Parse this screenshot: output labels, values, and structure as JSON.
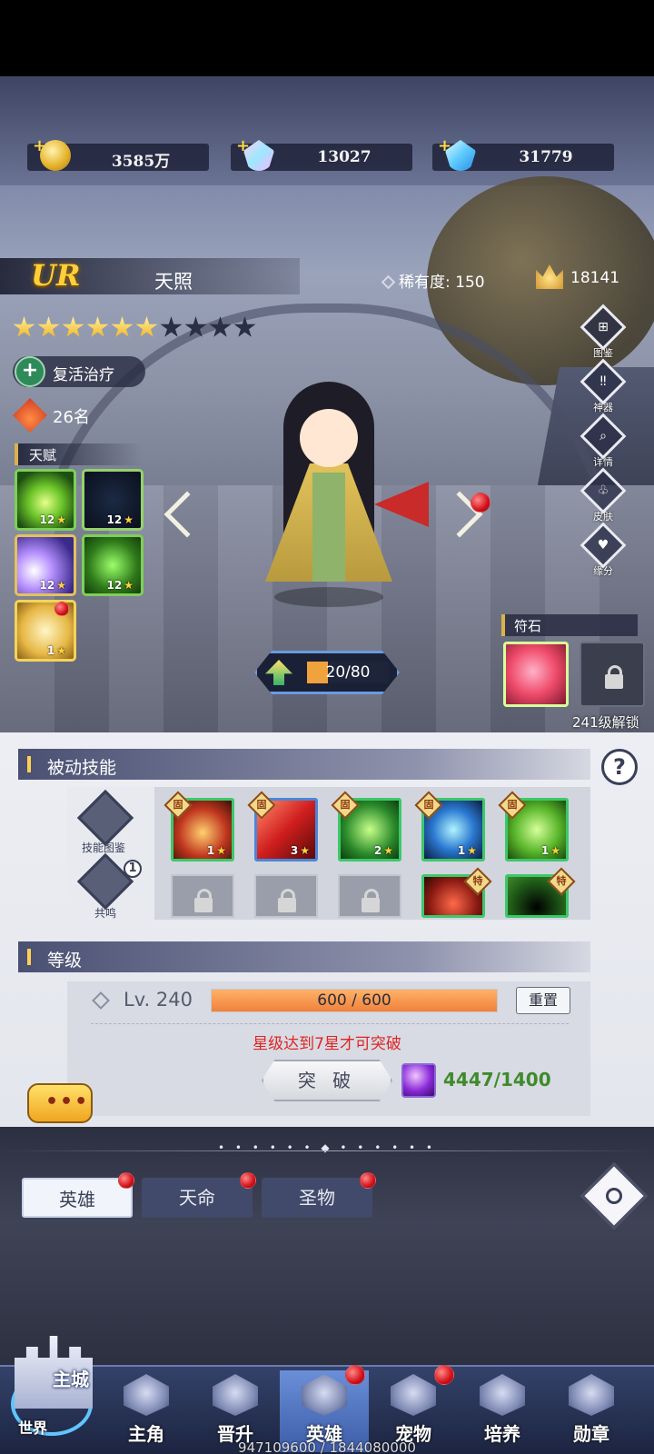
{
  "currency": {
    "gold": "3585万",
    "crystal": "13027",
    "diamond": "31779"
  },
  "hero": {
    "grade": "UR",
    "name": "天照",
    "rarity_label": "稀有度:",
    "rarity_value": "150",
    "power": "18141",
    "stars_total": 10,
    "stars_lit": 6,
    "role": "复活治疗",
    "rank": "26名"
  },
  "talent": {
    "title": "天赋",
    "skills": [
      {
        "icon": "green-vortex-icon",
        "level": "12"
      },
      {
        "icon": "silhouette-duo-icon",
        "level": "12"
      },
      {
        "icon": "purple-slash-icon",
        "level": "12"
      },
      {
        "icon": "green-dragon-icon",
        "level": "12"
      },
      {
        "icon": "gold-shield-icon",
        "level": "1"
      }
    ]
  },
  "side_menu": [
    {
      "icon": "codex-icon",
      "label": "图鉴"
    },
    {
      "icon": "artifact-icon",
      "label": "神器"
    },
    {
      "icon": "detail-icon",
      "label": "详情"
    },
    {
      "icon": "skin-icon",
      "label": "皮肤"
    },
    {
      "icon": "bond-icon",
      "label": "缘分"
    }
  ],
  "level_progress": {
    "text": "20/80",
    "fraction": 0.25
  },
  "rune": {
    "title": "符石",
    "unlock_text": "241级解锁"
  },
  "passive": {
    "title": "被动技能",
    "help": "?",
    "left_buttons": {
      "codex": "技能图鉴",
      "resonance": "共鸣",
      "resonance_badge": "1"
    },
    "fixed_tag": "固",
    "special_tag": "特",
    "skills": [
      {
        "icon": "bomb-soldier-icon",
        "level": "1"
      },
      {
        "icon": "red-sword-icon",
        "level": "3"
      },
      {
        "icon": "green-bamboo-icon",
        "level": "2"
      },
      {
        "icon": "blue-vortex-icon",
        "level": "1"
      },
      {
        "icon": "green-leaf-icon",
        "level": "1"
      }
    ]
  },
  "level": {
    "title": "等级",
    "lv_text": "Lv. 240",
    "xp_text": "600 / 600",
    "xp_fraction": 1.0,
    "reset": "重置",
    "warning": "星级达到7星才可突破",
    "break_label": "突 破",
    "material": "4447/1400"
  },
  "chat": {
    "label": "•••"
  },
  "tabs": [
    {
      "label": "英雄",
      "active": true
    },
    {
      "label": "天命",
      "active": false
    },
    {
      "label": "圣物",
      "active": false
    }
  ],
  "nav": {
    "castle_main": "主城",
    "castle_world": "世界",
    "items": [
      {
        "label": "主角"
      },
      {
        "label": "晋升"
      },
      {
        "label": "英雄"
      },
      {
        "label": "宠物"
      },
      {
        "label": "培养"
      },
      {
        "label": "勋章"
      }
    ],
    "exp_text": "947109600 / 1844080000"
  }
}
